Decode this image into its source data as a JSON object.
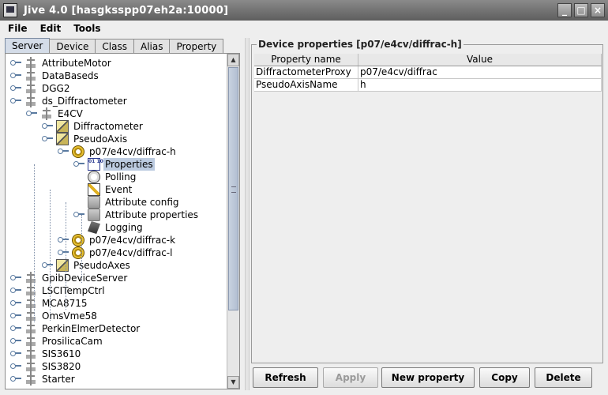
{
  "window": {
    "title": "Jive 4.0  [hasgksspp07eh2a:10000]",
    "buttons": [
      "_",
      "□",
      "×"
    ]
  },
  "menu": [
    "File",
    "Edit",
    "Tools"
  ],
  "tabs": [
    {
      "label": "Server",
      "active": true
    },
    {
      "label": "Device",
      "active": false
    },
    {
      "label": "Class",
      "active": false
    },
    {
      "label": "Alias",
      "active": false
    },
    {
      "label": "Property",
      "active": false
    }
  ],
  "tree": [
    {
      "label": "AttributeMotor",
      "icon": "server-icon",
      "level": 0,
      "handle": true
    },
    {
      "label": "DataBaseds",
      "icon": "server-icon",
      "level": 0,
      "handle": true
    },
    {
      "label": "DGG2",
      "icon": "server-icon",
      "level": 0,
      "handle": true
    },
    {
      "label": "ds_Diffractometer",
      "icon": "server-icon",
      "level": 0,
      "handle": true
    },
    {
      "label": "E4CV",
      "icon": "server-icon",
      "level": 1,
      "handle": true
    },
    {
      "label": "Diffractometer",
      "icon": "class-icon",
      "level": 2,
      "handle": true
    },
    {
      "label": "PseudoAxis",
      "icon": "class-icon",
      "level": 2,
      "handle": true
    },
    {
      "label": "p07/e4cv/diffrac-h",
      "icon": "device-icon",
      "level": 3,
      "handle": true
    },
    {
      "label": "Properties",
      "icon": "properties-icon",
      "level": 4,
      "handle": true,
      "selected": true
    },
    {
      "label": "Polling",
      "icon": "polling-icon",
      "level": 4,
      "handle": false
    },
    {
      "label": "Event",
      "icon": "event-icon",
      "level": 4,
      "handle": false
    },
    {
      "label": "Attribute config",
      "icon": "attribute-icon",
      "level": 4,
      "handle": false
    },
    {
      "label": "Attribute properties",
      "icon": "attribute-icon",
      "level": 4,
      "handle": true
    },
    {
      "label": "Logging",
      "icon": "logging-icon",
      "level": 4,
      "handle": false
    },
    {
      "label": "p07/e4cv/diffrac-k",
      "icon": "device-icon",
      "level": 3,
      "handle": true
    },
    {
      "label": "p07/e4cv/diffrac-l",
      "icon": "device-icon",
      "level": 3,
      "handle": true
    },
    {
      "label": "PseudoAxes",
      "icon": "class-icon",
      "level": 2,
      "handle": true
    },
    {
      "label": "GpibDeviceServer",
      "icon": "server-icon",
      "level": 0,
      "handle": true
    },
    {
      "label": "LSCITempCtrl",
      "icon": "server-icon",
      "level": 0,
      "handle": true
    },
    {
      "label": "MCA8715",
      "icon": "server-icon",
      "level": 0,
      "handle": true
    },
    {
      "label": "OmsVme58",
      "icon": "server-icon",
      "level": 0,
      "handle": true
    },
    {
      "label": "PerkinElmerDetector",
      "icon": "server-icon",
      "level": 0,
      "handle": true
    },
    {
      "label": "ProsilicaCam",
      "icon": "server-icon",
      "level": 0,
      "handle": true
    },
    {
      "label": "SIS3610",
      "icon": "server-icon",
      "level": 0,
      "handle": true
    },
    {
      "label": "SIS3820",
      "icon": "server-icon",
      "level": 0,
      "handle": true
    },
    {
      "label": "Starter",
      "icon": "server-icon",
      "level": 0,
      "handle": true
    }
  ],
  "panel": {
    "title": "Device properties [p07/e4cv/diffrac-h]",
    "columns": [
      "Property name",
      "Value"
    ],
    "rows": [
      [
        "DiffractometerProxy",
        "p07/e4cv/diffrac"
      ],
      [
        "PseudoAxisName",
        "h"
      ]
    ]
  },
  "buttons": [
    {
      "label": "Refresh",
      "enabled": true
    },
    {
      "label": "Apply",
      "enabled": false
    },
    {
      "label": "New property",
      "enabled": true
    },
    {
      "label": "Copy",
      "enabled": true
    },
    {
      "label": "Delete",
      "enabled": true
    }
  ],
  "colors": {
    "selection": "#bccbe0",
    "titlebar": "#5e5e5e"
  }
}
